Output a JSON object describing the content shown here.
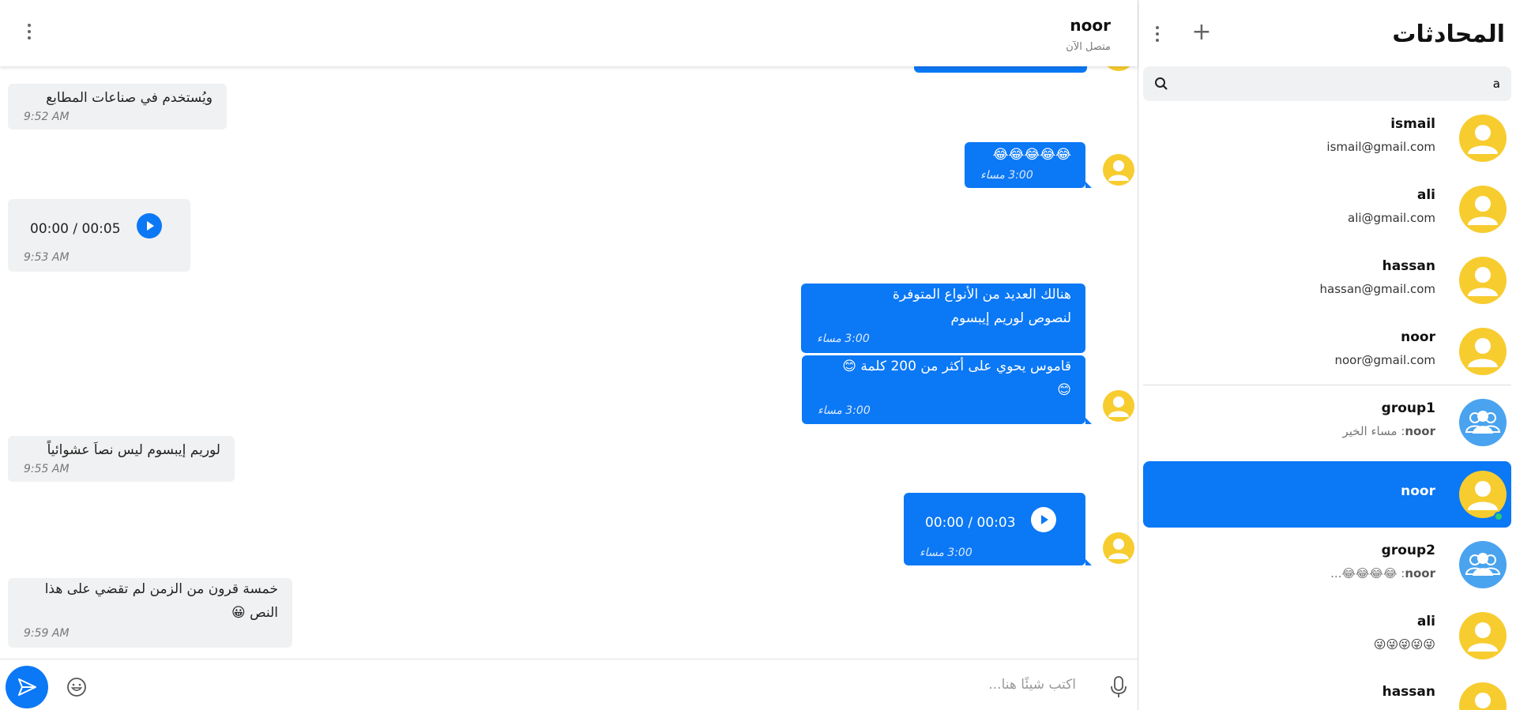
{
  "sidebar": {
    "title": "المحادثات",
    "search": {
      "value": "a",
      "placeholder": ""
    },
    "contacts": [
      {
        "name": "ismail",
        "sub": "ismail@gmail.com"
      },
      {
        "name": "ali",
        "sub": "ali@gmail.com"
      },
      {
        "name": "hassan",
        "sub": "hassan@gmail.com"
      },
      {
        "name": "noor",
        "sub": "noor@gmail.com"
      }
    ],
    "chats": [
      {
        "name": "group1",
        "sender": "noor",
        "preview": "مساء الخير"
      },
      {
        "name": "noor",
        "active": true
      },
      {
        "name": "group2",
        "sender": "noor",
        "preview": "😂😂😂😂..."
      },
      {
        "name": "ali",
        "preview": "😜😜😜😜😜"
      },
      {
        "name": "hassan",
        "preview": ""
      }
    ]
  },
  "header": {
    "name": "noor",
    "status": "متصل الآن"
  },
  "messages": [
    {
      "dir": "in",
      "text": "ويُستخدم في صناعات المطابع",
      "time": "9:52 AM"
    },
    {
      "dir": "out",
      "text": "😂😂😂😂😂",
      "time": "3:00 مساء"
    },
    {
      "dir": "in",
      "audio": "00:00 / 00:05",
      "time": "9:53 AM"
    },
    {
      "dir": "out",
      "lines": [
        "هنالك العديد من الأنواع المتوفرة",
        "لنصوص لوريم إيبسوم"
      ],
      "time": "3:00 مساء"
    },
    {
      "dir": "out",
      "lines": [
        "قاموس يحوي على أكثر من 200 كلمة 😊",
        "😊"
      ],
      "time": "3:00 مساء"
    },
    {
      "dir": "in",
      "text": "لوريم إيبسوم ليس نصاَ عشوائياً",
      "time": "9:55 AM"
    },
    {
      "dir": "out",
      "audio": "00:00 / 00:03",
      "time": "3:00 مساء"
    },
    {
      "dir": "in",
      "lines": [
        "خمسة قرون من الزمن لم تقضي على هذا",
        "النص 😀"
      ],
      "time": "9:59 AM"
    }
  ],
  "composer": {
    "placeholder": "اكتب شيئًا هنا..."
  },
  "colors": {
    "accent": "#0b78f5",
    "avatar_user": "#f7cc2f",
    "avatar_group": "#4aa3ef",
    "online": "#2ecc71",
    "incoming_bg": "#f0f1f2"
  },
  "icons": [
    "search-icon",
    "plus-icon",
    "kebab-menu-icon",
    "user-avatar-icon",
    "group-avatar-icon",
    "play-icon",
    "send-icon",
    "emoji-icon",
    "microphone-icon"
  ]
}
